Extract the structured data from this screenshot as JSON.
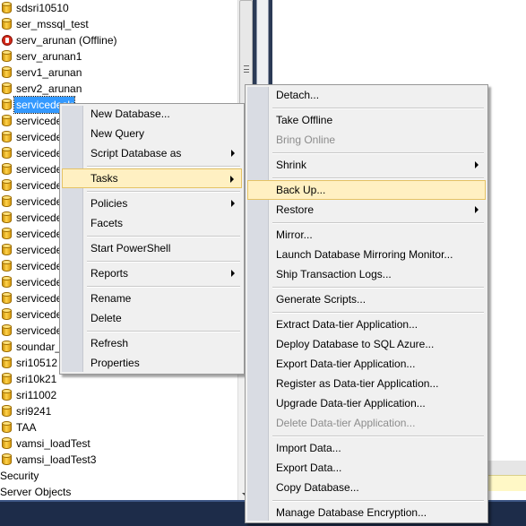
{
  "tree": {
    "items": [
      {
        "label": "sdsri10510",
        "icon": "database-icon"
      },
      {
        "label": "ser_mssql_test",
        "icon": "database-icon"
      },
      {
        "label": "serv_arunan (Offline)",
        "icon": "offline-database-icon"
      },
      {
        "label": "serv_arunan1",
        "icon": "database-icon"
      },
      {
        "label": "serv1_arunan",
        "icon": "database-icon"
      },
      {
        "label": "serv2_arunan",
        "icon": "database-icon"
      },
      {
        "label": "servicedesk",
        "icon": "database-icon",
        "selected": true
      },
      {
        "label": "servicedesk",
        "icon": "database-icon"
      },
      {
        "label": "servicedesk",
        "icon": "database-icon"
      },
      {
        "label": "servicedesk",
        "icon": "database-icon"
      },
      {
        "label": "servicedesk",
        "icon": "database-icon"
      },
      {
        "label": "servicedesk",
        "icon": "database-icon"
      },
      {
        "label": "servicedesk",
        "icon": "database-icon"
      },
      {
        "label": "servicedesk",
        "icon": "database-icon"
      },
      {
        "label": "servicedesk",
        "icon": "database-icon"
      },
      {
        "label": "servicedesk",
        "icon": "database-icon"
      },
      {
        "label": "servicedesk",
        "icon": "database-icon"
      },
      {
        "label": "servicedesk",
        "icon": "database-icon"
      },
      {
        "label": "servicedesk",
        "icon": "database-icon"
      },
      {
        "label": "servicedesk",
        "icon": "database-icon"
      },
      {
        "label": "servicedesk",
        "icon": "database-icon"
      },
      {
        "label": "soundar_",
        "icon": "database-icon"
      },
      {
        "label": "sri10512",
        "icon": "database-icon"
      },
      {
        "label": "sri10k21",
        "icon": "database-icon"
      },
      {
        "label": "sri11002",
        "icon": "database-icon"
      },
      {
        "label": "sri9241",
        "icon": "database-icon"
      },
      {
        "label": "TAA",
        "icon": "database-icon"
      },
      {
        "label": "vamsi_loadTest",
        "icon": "database-icon"
      },
      {
        "label": "vamsi_loadTest3",
        "icon": "database-icon"
      },
      {
        "label": "Security",
        "icon": ""
      },
      {
        "label": "Server Objects",
        "icon": ""
      }
    ]
  },
  "db_menu": {
    "items": [
      {
        "label": "New Database..."
      },
      {
        "label": "New Query"
      },
      {
        "label": "Script Database as",
        "submenu": true
      },
      {
        "sep": true
      },
      {
        "label": "Tasks",
        "submenu": true,
        "highlighted": true
      },
      {
        "sep": true
      },
      {
        "label": "Policies",
        "submenu": true
      },
      {
        "label": "Facets"
      },
      {
        "sep": true
      },
      {
        "label": "Start PowerShell"
      },
      {
        "sep": true
      },
      {
        "label": "Reports",
        "submenu": true
      },
      {
        "sep": true
      },
      {
        "label": "Rename"
      },
      {
        "label": "Delete"
      },
      {
        "sep": true
      },
      {
        "label": "Refresh"
      },
      {
        "label": "Properties"
      }
    ]
  },
  "tasks_menu": {
    "items": [
      {
        "label": "Detach..."
      },
      {
        "sep": true
      },
      {
        "label": "Take Offline"
      },
      {
        "label": "Bring Online",
        "disabled": true
      },
      {
        "sep": true
      },
      {
        "label": "Shrink",
        "submenu": true
      },
      {
        "sep": true
      },
      {
        "label": "Back Up...",
        "highlighted": true
      },
      {
        "label": "Restore",
        "submenu": true
      },
      {
        "sep": true
      },
      {
        "label": "Mirror..."
      },
      {
        "label": "Launch Database Mirroring Monitor..."
      },
      {
        "label": "Ship Transaction Logs..."
      },
      {
        "sep": true
      },
      {
        "label": "Generate Scripts..."
      },
      {
        "sep": true
      },
      {
        "label": "Extract Data-tier Application..."
      },
      {
        "label": "Deploy Database to SQL Azure..."
      },
      {
        "label": "Export Data-tier Application..."
      },
      {
        "label": "Register as Data-tier Application..."
      },
      {
        "label": "Upgrade Data-tier Application..."
      },
      {
        "label": "Delete Data-tier Application...",
        "disabled": true
      },
      {
        "sep": true
      },
      {
        "label": "Import Data..."
      },
      {
        "label": "Export Data..."
      },
      {
        "label": "Copy Database..."
      },
      {
        "sep": true
      },
      {
        "label": "Manage Database Encryption..."
      }
    ]
  }
}
